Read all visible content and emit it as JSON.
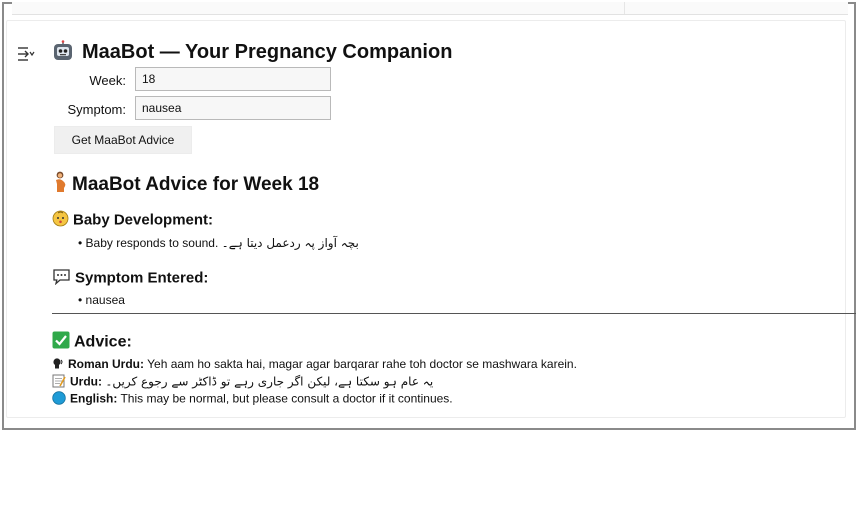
{
  "app": {
    "title": "MaaBot — Your Pregnancy Companion",
    "title_icon": "robot-face-icon"
  },
  "form": {
    "week_label": "Week:",
    "week_value": "18",
    "symptom_label": "Symptom:",
    "symptom_value": "nausea",
    "submit_label": "Get MaaBot Advice"
  },
  "result": {
    "heading": "MaaBot Advice for Week 18",
    "heading_icon": "pregnant-woman-icon",
    "baby": {
      "heading": "Baby Development:",
      "icon": "baby-face-icon",
      "item_en": "Baby responds to sound.",
      "item_ur": "بچہ آواز پہ ردعمل دیتا ہے۔"
    },
    "symptom": {
      "heading": "Symptom Entered:",
      "icon": "speech-bubble-icon",
      "item": "nausea"
    },
    "advice": {
      "heading": "Advice:",
      "icon": "check-mark-icon",
      "roman_label": "Roman Urdu:",
      "roman_text": "Yeh aam ho sakta hai, magar agar barqarar rahe toh doctor se mashwara karein.",
      "urdu_label": "Urdu:",
      "urdu_text": "یہ عام ہو سکتا ہے، لیکن اگر جاری رہے تو ڈاکٹر سے رجوع کریں۔",
      "english_label": "English:",
      "english_text": "This may be normal, but please consult a doctor if it continues."
    }
  },
  "colors": {
    "frame": "#8a8a8a",
    "check_green": "#2fa94a",
    "globe_blue": "#1f9bd6"
  }
}
